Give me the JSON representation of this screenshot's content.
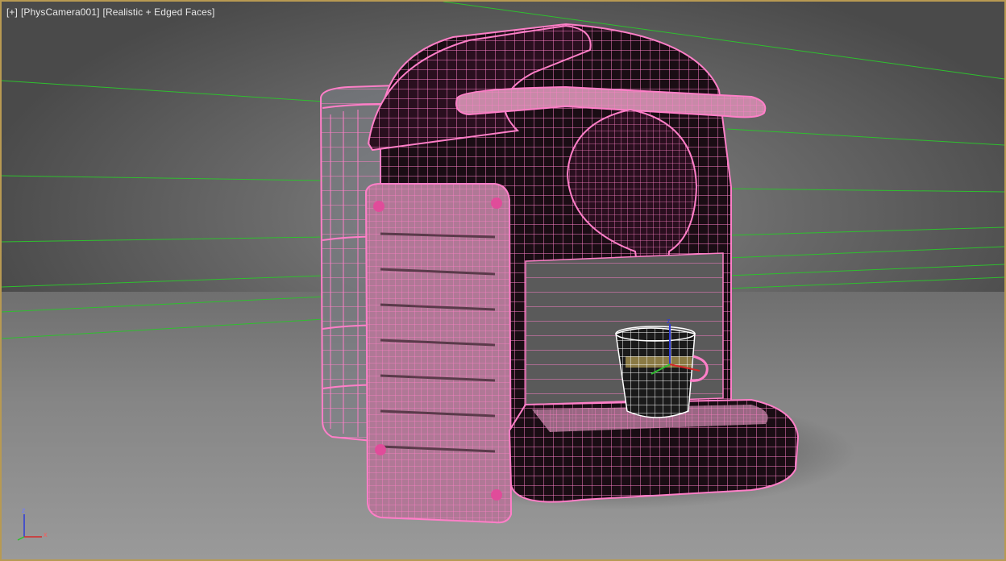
{
  "viewport": {
    "menu_label": "[+]",
    "camera_label": "[PhysCamera001]",
    "shading_label": "[Realistic + Edged Faces]"
  },
  "axis_gizmo": {
    "z_label": "z",
    "x_label": "x"
  },
  "cup_gizmo": {
    "z_label": "z"
  },
  "colors": {
    "frame_border": "#b89a52",
    "wire_pink": "#ff7fc8",
    "grid_green": "#2ec02e",
    "label_text": "#e8e8e8"
  }
}
